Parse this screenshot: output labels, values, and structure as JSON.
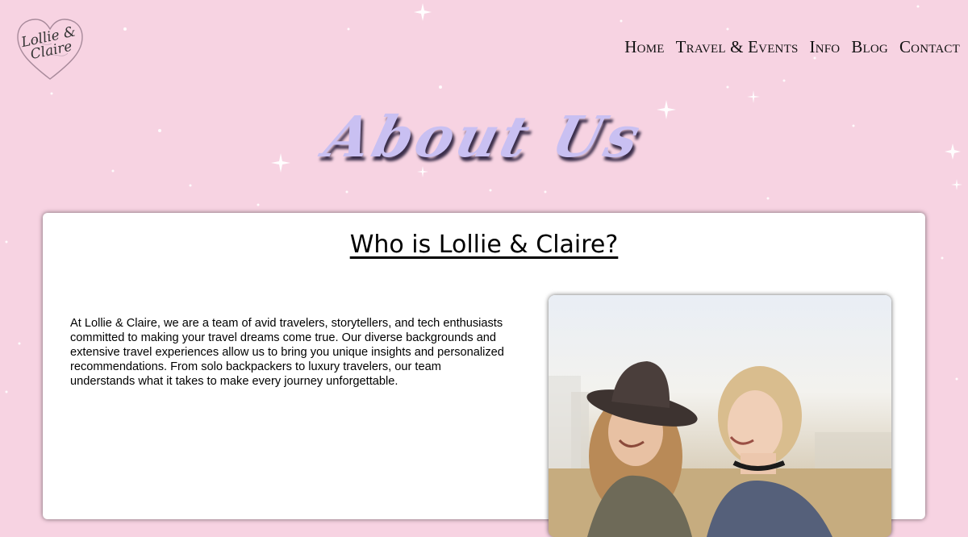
{
  "logo": {
    "line1": "Lollie &",
    "line2": "Claire"
  },
  "nav": {
    "items": [
      "Home",
      "Travel & Events",
      "Info",
      "Blog",
      "Contact"
    ]
  },
  "page": {
    "title": "About Us"
  },
  "about": {
    "heading": "Who is Lollie & Claire?",
    "body": "At Lollie & Claire, we are a team of avid travelers, storytellers, and tech enthusiasts committed to making your travel dreams come true. Our diverse backgrounds and extensive travel experiences allow us to bring you unique insights and personalized recommendations. From solo backpackers to luxury travelers, our team understands what it takes to make every journey unforgettable."
  },
  "colors": {
    "background": "#f7d3e2",
    "title": "#c9c0f2",
    "card": "#ffffff"
  }
}
